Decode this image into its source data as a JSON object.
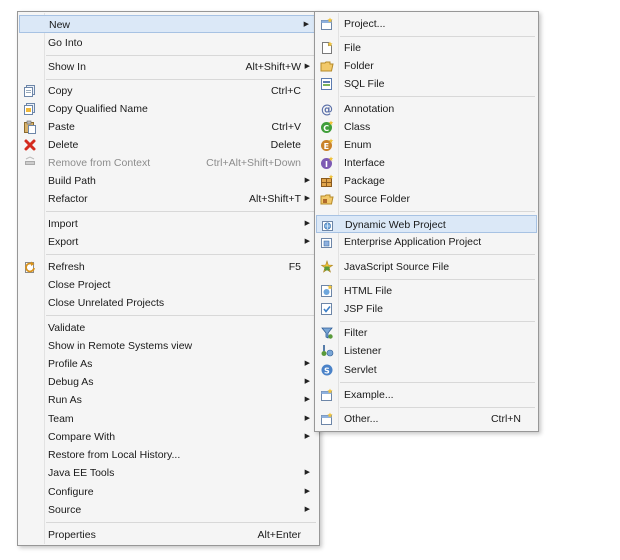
{
  "main_menu": {
    "items": [
      {
        "label": "New",
        "arrow": "▶"
      },
      {
        "label": "Go Into"
      },
      {
        "label": "Show In",
        "shortcut": "Alt+Shift+W",
        "arrow": "▶"
      },
      {
        "label": "Copy",
        "shortcut": "Ctrl+C",
        "icon": "copy-icon"
      },
      {
        "label": "Copy Qualified Name",
        "icon": "copy-qualified-name-icon"
      },
      {
        "label": "Paste",
        "shortcut": "Ctrl+V",
        "icon": "paste-icon"
      },
      {
        "label": "Delete",
        "shortcut": "Delete",
        "icon": "delete-icon"
      },
      {
        "label": "Remove from Context",
        "shortcut": "Ctrl+Alt+Shift+Down",
        "icon": "remove-context-icon",
        "disabled": true
      },
      {
        "label": "Build Path",
        "arrow": "▶"
      },
      {
        "label": "Refactor",
        "shortcut": "Alt+Shift+T",
        "arrow": "▶"
      },
      {
        "label": "Import",
        "arrow": "▶"
      },
      {
        "label": "Export",
        "arrow": "▶"
      },
      {
        "label": "Refresh",
        "shortcut": "F5",
        "icon": "refresh-icon"
      },
      {
        "label": "Close Project"
      },
      {
        "label": "Close Unrelated Projects"
      },
      {
        "label": "Validate"
      },
      {
        "label": "Show in Remote Systems view"
      },
      {
        "label": "Profile As",
        "arrow": "▶"
      },
      {
        "label": "Debug As",
        "arrow": "▶"
      },
      {
        "label": "Run As",
        "arrow": "▶"
      },
      {
        "label": "Team",
        "arrow": "▶"
      },
      {
        "label": "Compare With",
        "arrow": "▶"
      },
      {
        "label": "Restore from Local History..."
      },
      {
        "label": "Java EE Tools",
        "arrow": "▶"
      },
      {
        "label": "Configure",
        "arrow": "▶"
      },
      {
        "label": "Source",
        "arrow": "▶"
      },
      {
        "label": "Properties",
        "shortcut": "Alt+Enter"
      }
    ]
  },
  "submenu_new": {
    "items": [
      {
        "label": "Project...",
        "icon": "new-project-icon"
      },
      {
        "label": "File",
        "icon": "file-icon"
      },
      {
        "label": "Folder",
        "icon": "folder-icon"
      },
      {
        "label": "SQL File",
        "icon": "sql-file-icon"
      },
      {
        "label": "Annotation",
        "icon": "annotation-icon"
      },
      {
        "label": "Class",
        "icon": "class-icon"
      },
      {
        "label": "Enum",
        "icon": "enum-icon"
      },
      {
        "label": "Interface",
        "icon": "interface-icon"
      },
      {
        "label": "Package",
        "icon": "package-icon"
      },
      {
        "label": "Source Folder",
        "icon": "source-folder-icon"
      },
      {
        "label": "Dynamic Web Project",
        "icon": "dynamic-web-project-icon"
      },
      {
        "label": "Enterprise Application Project",
        "icon": "enterprise-application-project-icon"
      },
      {
        "label": "JavaScript Source File",
        "icon": "javascript-source-file-icon"
      },
      {
        "label": "HTML File",
        "icon": "html-file-icon"
      },
      {
        "label": "JSP File",
        "icon": "jsp-file-icon"
      },
      {
        "label": "Filter",
        "icon": "filter-icon"
      },
      {
        "label": "Listener",
        "icon": "listener-icon"
      },
      {
        "label": "Servlet",
        "icon": "servlet-icon"
      },
      {
        "label": "Example...",
        "icon": "example-icon"
      },
      {
        "label": "Other...",
        "shortcut": "Ctrl+N",
        "icon": "other-icon"
      }
    ]
  }
}
